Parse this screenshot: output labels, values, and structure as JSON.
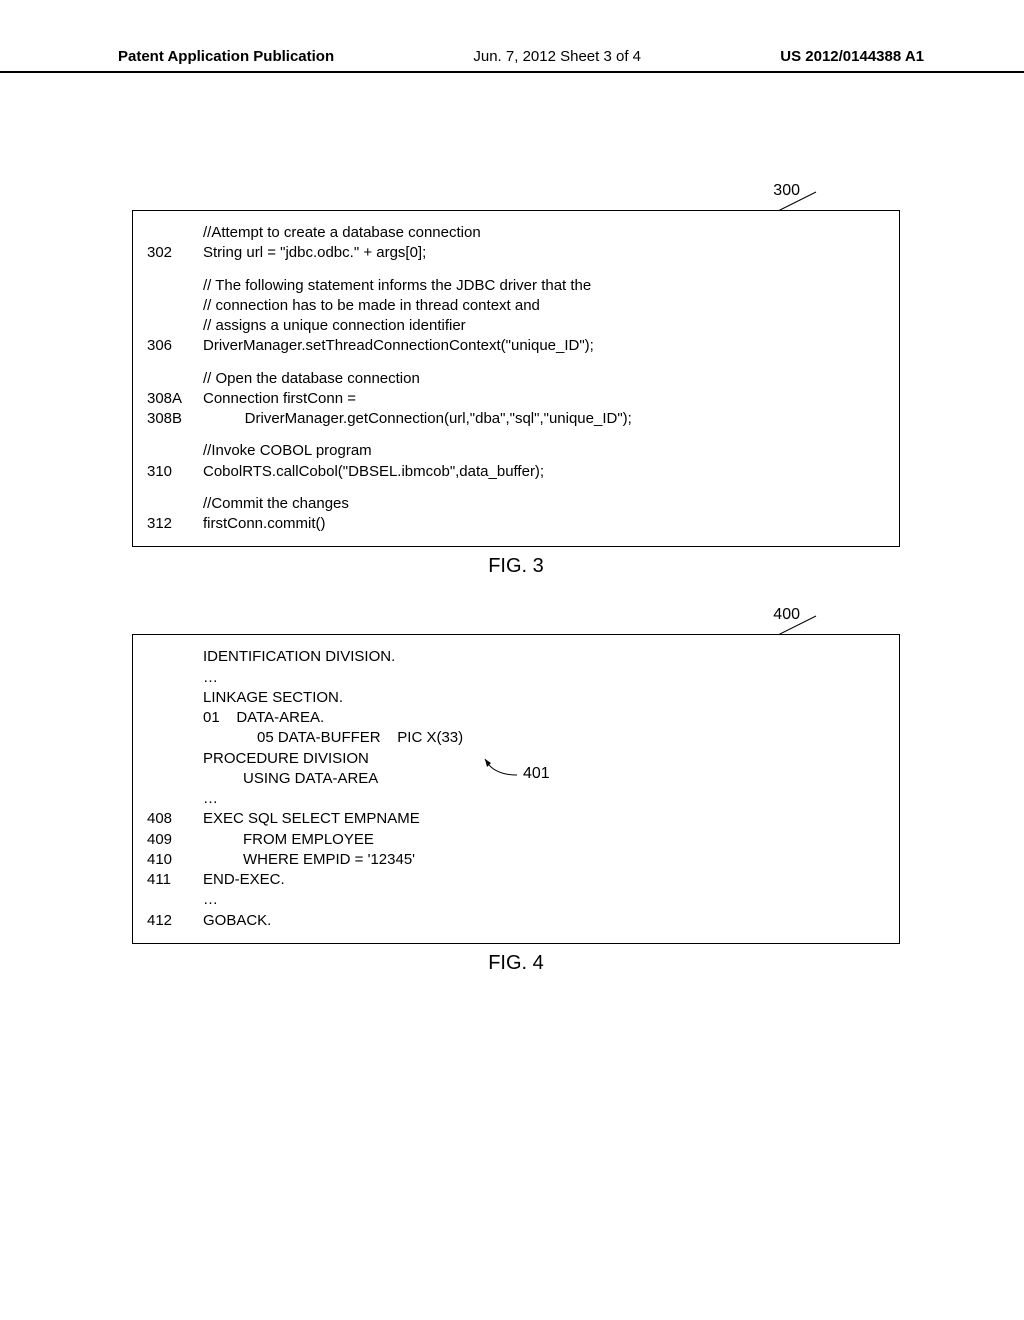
{
  "header": {
    "left": "Patent Application Publication",
    "center": "Jun. 7, 2012   Sheet 3 of 4",
    "right": "US 2012/0144388 A1"
  },
  "fig3": {
    "label": "300",
    "caption": "FIG. 3",
    "lines": [
      {
        "num": "",
        "text": "//Attempt to create a database connection"
      },
      {
        "num": "302",
        "text": "String url = \"jdbc.odbc.\" + args[0];"
      },
      {
        "blank": true
      },
      {
        "num": "",
        "text": "// The following statement informs the JDBC driver that the"
      },
      {
        "num": "",
        "text": "// connection has to be made in thread context and"
      },
      {
        "num": "",
        "text": "// assigns a unique connection identifier"
      },
      {
        "num": "306",
        "text": "DriverManager.setThreadConnectionContext(\"unique_ID\");"
      },
      {
        "blank": true
      },
      {
        "num": "",
        "text": "// Open the database connection"
      },
      {
        "num": "308A",
        "text": "Connection firstConn ="
      },
      {
        "num": "308B",
        "text": "          DriverManager.getConnection(url,\"dba\",\"sql\",\"unique_ID\");"
      },
      {
        "blank": true
      },
      {
        "num": "",
        "text": "//Invoke COBOL program"
      },
      {
        "num": "310",
        "text": "CobolRTS.callCobol(\"DBSEL.ibmcob\",data_buffer);"
      },
      {
        "blank": true
      },
      {
        "num": "",
        "text": "//Commit the changes"
      },
      {
        "num": "312",
        "text": "firstConn.commit()"
      }
    ]
  },
  "fig4": {
    "label": "400",
    "callout": "401",
    "caption": "FIG. 4",
    "lines": [
      {
        "num": "",
        "text": "IDENTIFICATION DIVISION."
      },
      {
        "num": "",
        "text": "…"
      },
      {
        "num": "",
        "text": "LINKAGE SECTION."
      },
      {
        "num": "",
        "text": "01    DATA-AREA.",
        "cls": ""
      },
      {
        "num": "",
        "text": "05 DATA-BUFFER    PIC X(33)",
        "cls": "indent-num2"
      },
      {
        "num": "",
        "text": "PROCEDURE DIVISION"
      },
      {
        "num": "",
        "text": "USING DATA-AREA",
        "cls": "indent-back1"
      },
      {
        "num": "",
        "text": "…"
      },
      {
        "num": "408",
        "text": "EXEC SQL SELECT EMPNAME"
      },
      {
        "num": "409",
        "text": "FROM EMPLOYEE",
        "cls": "indent-back1"
      },
      {
        "num": "410",
        "text": "WHERE EMPID = '12345'",
        "cls": "indent-back1"
      },
      {
        "num": "411",
        "text": "END-EXEC."
      },
      {
        "num": "",
        "text": "…"
      },
      {
        "num": "412",
        "text": "GOBACK."
      }
    ]
  }
}
